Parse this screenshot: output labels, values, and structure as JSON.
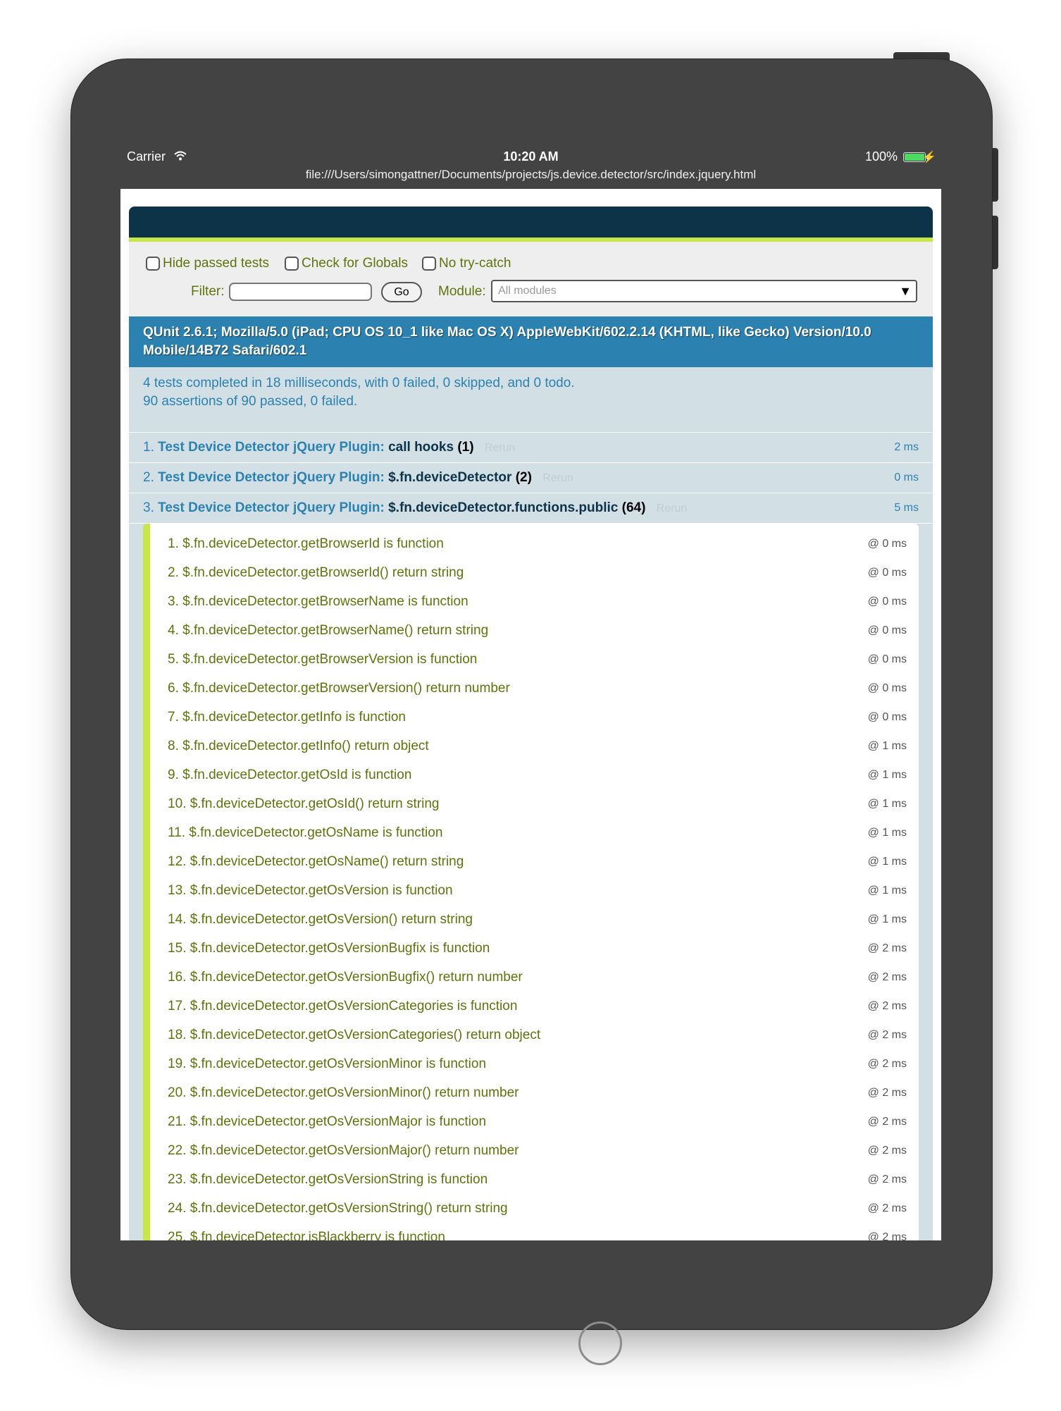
{
  "status_bar": {
    "carrier": "Carrier",
    "time": "10:20 AM",
    "battery": "100%",
    "url": "file:///Users/simongattner/Documents/projects/js.device.detector/src/index.jquery.html"
  },
  "toolbar": {
    "hide_passed": "Hide passed tests",
    "check_globals": "Check for Globals",
    "no_try_catch": "No try-catch",
    "filter_label": "Filter:",
    "filter_value": "",
    "go_label": "Go",
    "module_label": "Module:",
    "module_selected": "All modules"
  },
  "user_agent": "QUnit 2.6.1; Mozilla/5.0 (iPad; CPU OS 10_1 like Mac OS X) AppleWebKit/602.2.14 (KHTML, like Gecko) Version/10.0 Mobile/14B72 Safari/602.1",
  "summary": {
    "line1": "4 tests completed in 18 milliseconds, with 0 failed, 0 skipped, and 0 todo.",
    "line2": "90 assertions of 90 passed, 0 failed."
  },
  "tests": [
    {
      "index": "1.",
      "module": "Test Device Detector jQuery Plugin:",
      "name": "call hooks",
      "count": "(1)",
      "rerun": "Rerun",
      "runtime": "2 ms"
    },
    {
      "index": "2.",
      "module": "Test Device Detector jQuery Plugin:",
      "name": "$.fn.deviceDetector",
      "count": "(2)",
      "rerun": "Rerun",
      "runtime": "0 ms"
    },
    {
      "index": "3.",
      "module": "Test Device Detector jQuery Plugin:",
      "name": "$.fn.deviceDetector.functions.public",
      "count": "(64)",
      "rerun": "Rerun",
      "runtime": "5 ms"
    }
  ],
  "assertions": [
    {
      "text": "1. $.fn.deviceDetector.getBrowserId is function",
      "time": "@ 0 ms"
    },
    {
      "text": "2. $.fn.deviceDetector.getBrowserId() return string",
      "time": "@ 0 ms"
    },
    {
      "text": "3. $.fn.deviceDetector.getBrowserName is function",
      "time": "@ 0 ms"
    },
    {
      "text": "4. $.fn.deviceDetector.getBrowserName() return string",
      "time": "@ 0 ms"
    },
    {
      "text": "5. $.fn.deviceDetector.getBrowserVersion is function",
      "time": "@ 0 ms"
    },
    {
      "text": "6. $.fn.deviceDetector.getBrowserVersion() return number",
      "time": "@ 0 ms"
    },
    {
      "text": "7. $.fn.deviceDetector.getInfo is function",
      "time": "@ 0 ms"
    },
    {
      "text": "8. $.fn.deviceDetector.getInfo() return object",
      "time": "@ 1 ms"
    },
    {
      "text": "9. $.fn.deviceDetector.getOsId is function",
      "time": "@ 1 ms"
    },
    {
      "text": "10. $.fn.deviceDetector.getOsId() return string",
      "time": "@ 1 ms"
    },
    {
      "text": "11. $.fn.deviceDetector.getOsName is function",
      "time": "@ 1 ms"
    },
    {
      "text": "12. $.fn.deviceDetector.getOsName() return string",
      "time": "@ 1 ms"
    },
    {
      "text": "13. $.fn.deviceDetector.getOsVersion is function",
      "time": "@ 1 ms"
    },
    {
      "text": "14. $.fn.deviceDetector.getOsVersion() return string",
      "time": "@ 1 ms"
    },
    {
      "text": "15. $.fn.deviceDetector.getOsVersionBugfix is function",
      "time": "@ 2 ms"
    },
    {
      "text": "16. $.fn.deviceDetector.getOsVersionBugfix() return number",
      "time": "@ 2 ms"
    },
    {
      "text": "17. $.fn.deviceDetector.getOsVersionCategories is function",
      "time": "@ 2 ms"
    },
    {
      "text": "18. $.fn.deviceDetector.getOsVersionCategories() return object",
      "time": "@ 2 ms"
    },
    {
      "text": "19. $.fn.deviceDetector.getOsVersionMinor is function",
      "time": "@ 2 ms"
    },
    {
      "text": "20. $.fn.deviceDetector.getOsVersionMinor() return number",
      "time": "@ 2 ms"
    },
    {
      "text": "21. $.fn.deviceDetector.getOsVersionMajor is function",
      "time": "@ 2 ms"
    },
    {
      "text": "22. $.fn.deviceDetector.getOsVersionMajor() return number",
      "time": "@ 2 ms"
    },
    {
      "text": "23. $.fn.deviceDetector.getOsVersionString is function",
      "time": "@ 2 ms"
    },
    {
      "text": "24. $.fn.deviceDetector.getOsVersionString() return string",
      "time": "@ 2 ms"
    },
    {
      "text": "25. $.fn.deviceDetector.isBlackberry is function",
      "time": "@ 2 ms"
    }
  ]
}
